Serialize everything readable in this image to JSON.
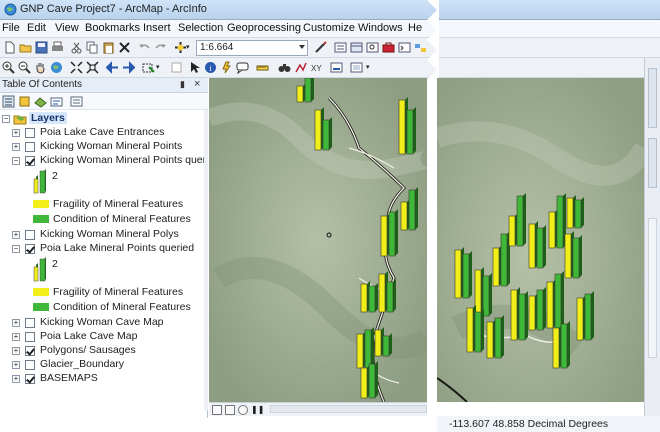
{
  "window": {
    "title": "GNP Cave Project7 - ArcMap - ArcInfo"
  },
  "menu": {
    "items": [
      "File",
      "Edit",
      "View",
      "Bookmarks",
      "Insert",
      "Selection",
      "Geoprocessing",
      "Customize",
      "Windows",
      "Help"
    ]
  },
  "toolbar": {
    "scale_value": "1:6.664"
  },
  "toc": {
    "title": "Table Of Contents",
    "root_label": "Layers",
    "layers": [
      {
        "label": "Poia Lake Cave Entrances",
        "checked": false
      },
      {
        "label": "Kicking Woman Mineral Points",
        "checked": false
      },
      {
        "label": "Kicking Woman Mineral Points queried",
        "checked": true
      },
      {
        "label": "Kicking Woman Mineral Polys",
        "checked": false
      },
      {
        "label": "Poia Lake  Mineral Points queried",
        "checked": true
      },
      {
        "label": "Kicking Woman Cave Map",
        "checked": false
      },
      {
        "label": "Poia Lake Cave Map",
        "checked": false
      },
      {
        "label": "Polygons/ Sausages",
        "checked": true
      },
      {
        "label": "Glacier_Boundary",
        "checked": false
      },
      {
        "label": "BASEMAPS",
        "checked": true
      }
    ],
    "legend_value": "2",
    "legend_items": [
      "Fragility of Mineral Features",
      "Condition of Mineral Features"
    ]
  },
  "status": {
    "coordinates": "-113.607  48.858 Decimal Degrees"
  },
  "colors": {
    "fragility": "#f2ee1a",
    "condition": "#3fb83a",
    "imagery": "#9eae93"
  }
}
